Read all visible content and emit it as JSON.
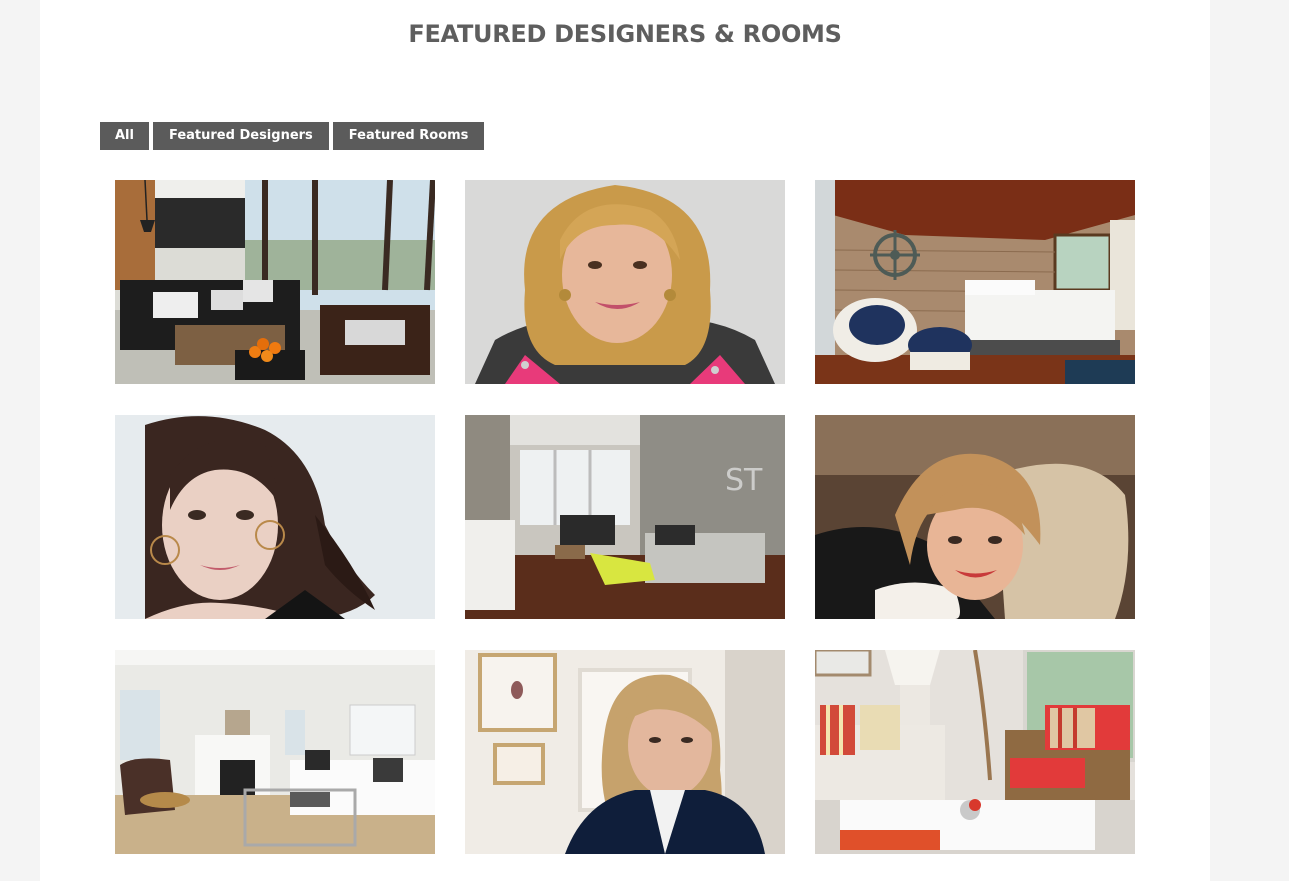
{
  "header": {
    "title": "FEATURED DESIGNERS & ROOMS"
  },
  "filters": [
    {
      "label": "All"
    },
    {
      "label": "Featured Designers"
    },
    {
      "label": "Featured Rooms"
    }
  ],
  "gallery": {
    "items": [
      {
        "kind": "room",
        "icon": "modern-living-room-image"
      },
      {
        "kind": "designer",
        "icon": "designer-portrait-image"
      },
      {
        "kind": "room",
        "icon": "nautical-bedroom-image"
      },
      {
        "kind": "designer",
        "icon": "designer-portrait-image"
      },
      {
        "kind": "room",
        "icon": "loft-living-room-image"
      },
      {
        "kind": "designer",
        "icon": "designer-portrait-image"
      },
      {
        "kind": "room",
        "icon": "white-living-room-image"
      },
      {
        "kind": "designer",
        "icon": "designer-portrait-image"
      },
      {
        "kind": "room",
        "icon": "coastal-living-room-image"
      }
    ]
  }
}
